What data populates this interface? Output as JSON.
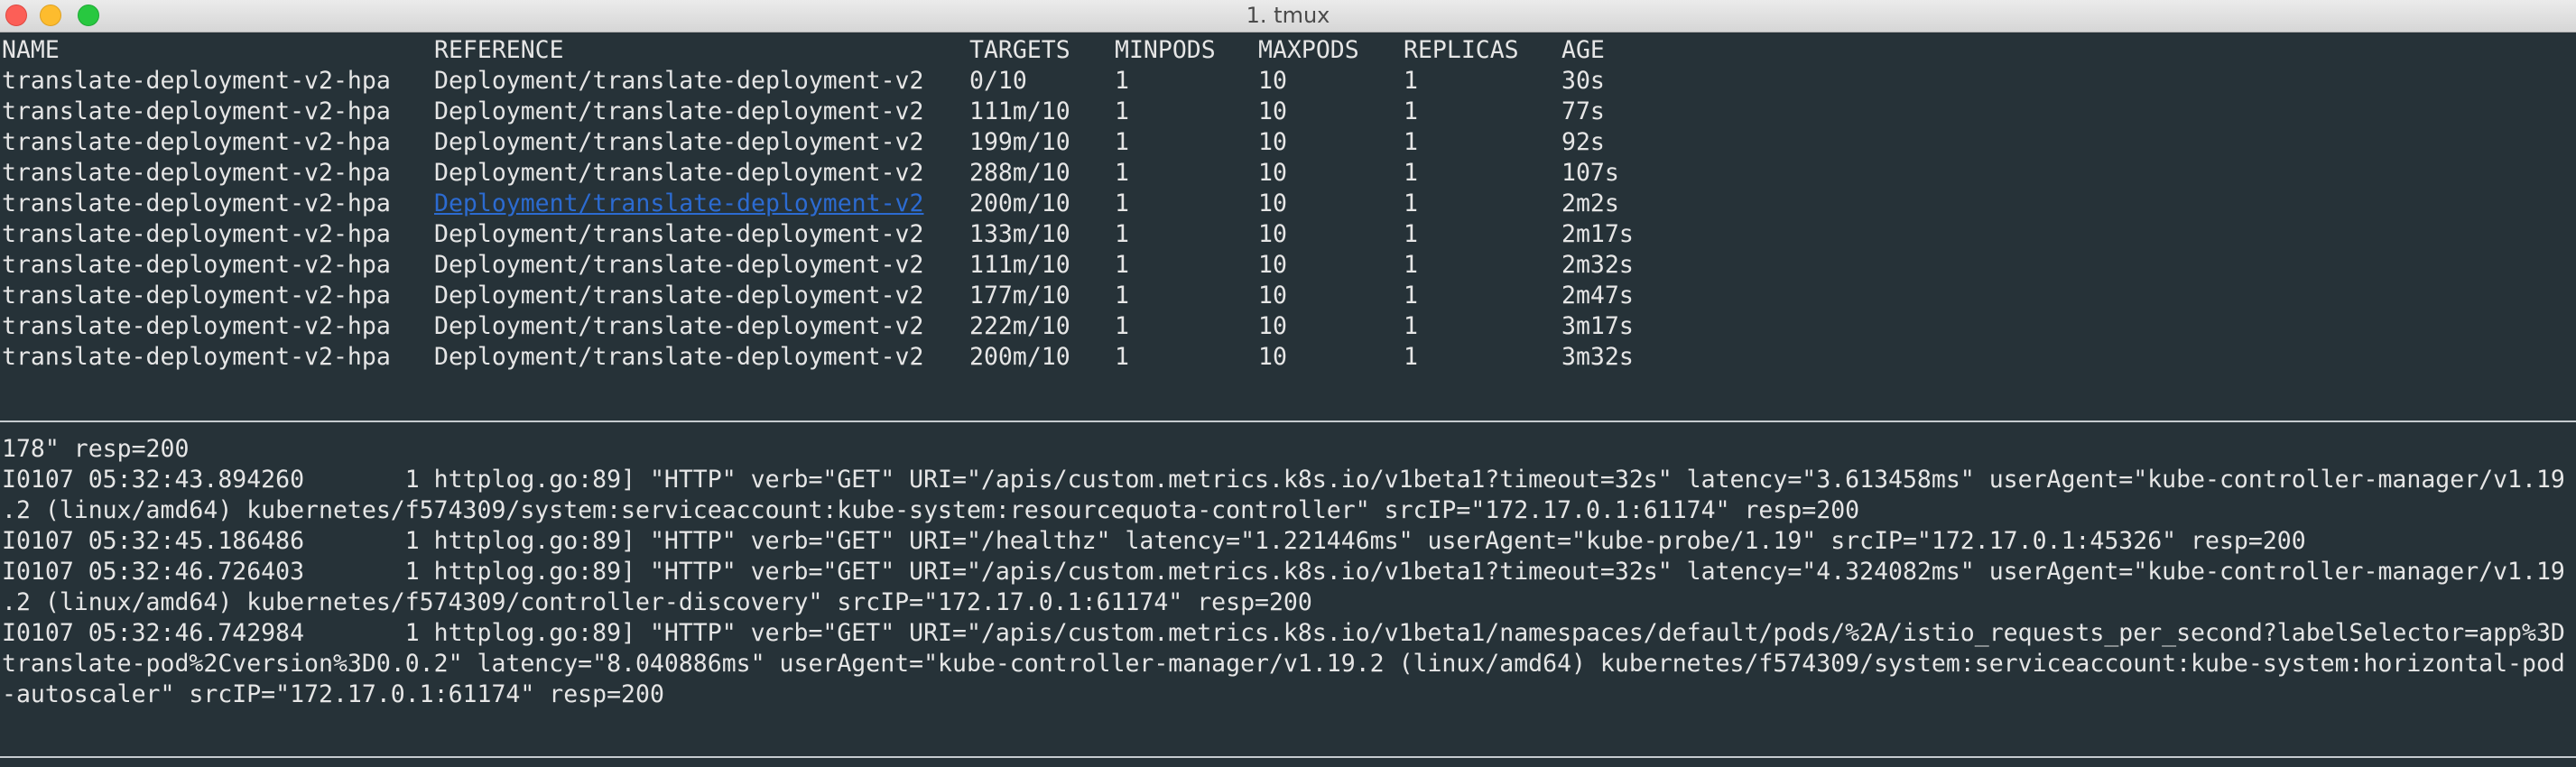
{
  "window": {
    "title": "1. tmux",
    "buttons": {
      "close": "close-icon",
      "minimize": "minimize-icon",
      "zoom": "zoom-icon"
    }
  },
  "colors": {
    "background": "#263238",
    "text": "#e6e6e6",
    "link": "#2c6bd1"
  },
  "hpa_table": {
    "headers": [
      "NAME",
      "REFERENCE",
      "TARGETS",
      "MINPODS",
      "MAXPODS",
      "REPLICAS",
      "AGE"
    ],
    "rows": [
      [
        "translate-deployment-v2-hpa",
        "Deployment/translate-deployment-v2",
        "0/10",
        "1",
        "10",
        "1",
        "30s"
      ],
      [
        "translate-deployment-v2-hpa",
        "Deployment/translate-deployment-v2",
        "111m/10",
        "1",
        "10",
        "1",
        "77s"
      ],
      [
        "translate-deployment-v2-hpa",
        "Deployment/translate-deployment-v2",
        "199m/10",
        "1",
        "10",
        "1",
        "92s"
      ],
      [
        "translate-deployment-v2-hpa",
        "Deployment/translate-deployment-v2",
        "288m/10",
        "1",
        "10",
        "1",
        "107s"
      ],
      [
        "translate-deployment-v2-hpa",
        "Deployment/translate-deployment-v2",
        "200m/10",
        "1",
        "10",
        "1",
        "2m2s"
      ],
      [
        "translate-deployment-v2-hpa",
        "Deployment/translate-deployment-v2",
        "133m/10",
        "1",
        "10",
        "1",
        "2m17s"
      ],
      [
        "translate-deployment-v2-hpa",
        "Deployment/translate-deployment-v2",
        "111m/10",
        "1",
        "10",
        "1",
        "2m32s"
      ],
      [
        "translate-deployment-v2-hpa",
        "Deployment/translate-deployment-v2",
        "177m/10",
        "1",
        "10",
        "1",
        "2m47s"
      ],
      [
        "translate-deployment-v2-hpa",
        "Deployment/translate-deployment-v2",
        "222m/10",
        "1",
        "10",
        "1",
        "3m17s"
      ],
      [
        "translate-deployment-v2-hpa",
        "Deployment/translate-deployment-v2",
        "200m/10",
        "1",
        "10",
        "1",
        "3m32s"
      ]
    ],
    "highlighted_row": 4
  },
  "log_lines": [
    "178\" resp=200",
    "I0107 05:32:43.894260       1 httplog.go:89] \"HTTP\" verb=\"GET\" URI=\"/apis/custom.metrics.k8s.io/v1beta1?timeout=32s\" latency=\"3.613458ms\" userAgent=\"kube-controller-manager/v1.19",
    ".2 (linux/amd64) kubernetes/f574309/system:serviceaccount:kube-system:resourcequota-controller\" srcIP=\"172.17.0.1:61174\" resp=200",
    "I0107 05:32:45.186486       1 httplog.go:89] \"HTTP\" verb=\"GET\" URI=\"/healthz\" latency=\"1.221446ms\" userAgent=\"kube-probe/1.19\" srcIP=\"172.17.0.1:45326\" resp=200",
    "I0107 05:32:46.726403       1 httplog.go:89] \"HTTP\" verb=\"GET\" URI=\"/apis/custom.metrics.k8s.io/v1beta1?timeout=32s\" latency=\"4.324082ms\" userAgent=\"kube-controller-manager/v1.19",
    ".2 (linux/amd64) kubernetes/f574309/controller-discovery\" srcIP=\"172.17.0.1:61174\" resp=200",
    "I0107 05:32:46.742984       1 httplog.go:89] \"HTTP\" verb=\"GET\" URI=\"/apis/custom.metrics.k8s.io/v1beta1/namespaces/default/pods/%2A/istio_requests_per_second?labelSelector=app%3D",
    "translate-pod%2Cversion%3D0.0.2\" latency=\"8.040886ms\" userAgent=\"kube-controller-manager/v1.19.2 (linux/amd64) kubernetes/f574309/system:serviceaccount:kube-system:horizontal-pod",
    "-autoscaler\" srcIP=\"172.17.0.1:61174\" resp=200"
  ]
}
